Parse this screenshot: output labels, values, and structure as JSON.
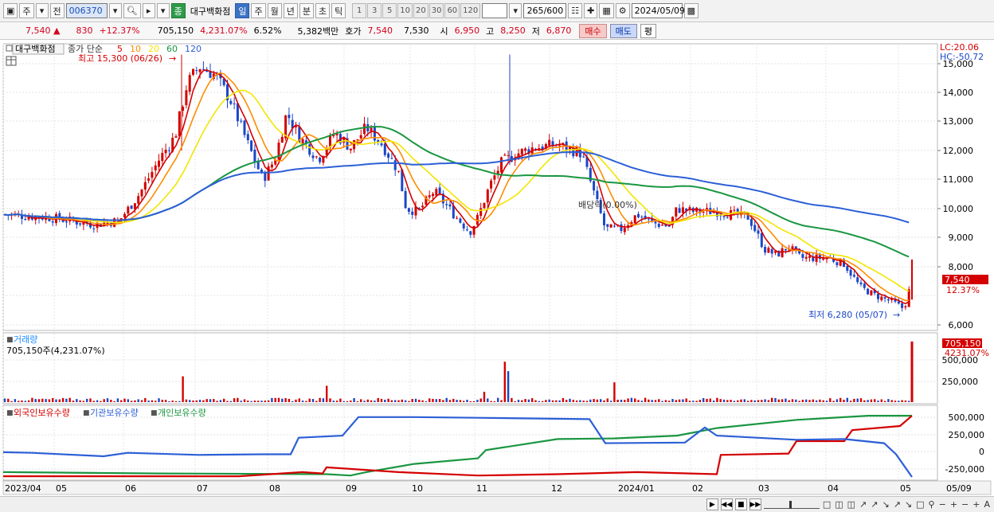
{
  "toolbar": {
    "type_selector": "주",
    "prev_label": "전",
    "stock_code": "006370",
    "stock_badge": "종",
    "stock_name": "대구백화점",
    "periods": [
      "일",
      "주",
      "월",
      "년",
      "분",
      "초",
      "틱"
    ],
    "active_period": "일",
    "minute_intervals": [
      "1",
      "3",
      "5",
      "10",
      "20",
      "30",
      "60",
      "120"
    ],
    "bar_count": "265",
    "bar_total": "/600",
    "date": "2024/05/09"
  },
  "quote": {
    "price": "7,540",
    "change": "830",
    "change_pct": "+12.37%",
    "volume": "705,150",
    "volume_pct": "4,231.07%",
    "turnover": "6.52%",
    "amount": "5,382백만",
    "bid_label": "호가",
    "bid1": "7,540",
    "bid2": "7,530",
    "open_label": "시",
    "open": "6,950",
    "high_label": "고",
    "high": "8,250",
    "low_label": "저",
    "low": "6,870",
    "buy_label": "매수",
    "sell_label": "매도",
    "avg_label": "평"
  },
  "price_panel": {
    "stock_name": "대구백화점",
    "legend_title": "종가 단순",
    "ma_periods": [
      "5",
      "10",
      "20",
      "60",
      "120"
    ],
    "ma_colors": [
      "#d40000",
      "#ff8c00",
      "#f2e600",
      "#1a9641",
      "#2c5fd6"
    ],
    "high_marker": "최고 15,300 (06/26)",
    "low_marker": "최저 6,280 (05/07)",
    "dividend_marker": "배당락(0.00%)",
    "lc_label": "LC:20.06",
    "hc_label": "HC:-50.72",
    "last_price": "7,540",
    "last_pct": "12.37%",
    "y_ticks": [
      "15,000",
      "14,000",
      "13,000",
      "12,000",
      "11,000",
      "10,000",
      "9,000",
      "8,000",
      "6,000"
    ]
  },
  "volume_panel": {
    "title": "거래량",
    "value_label": "705,150주(4,231.07%)",
    "last_value": "705,150",
    "last_pct": "4231.07%",
    "y_ticks": [
      "500,000",
      "250,000"
    ]
  },
  "holdings_panel": {
    "series": [
      "외국인보유수량",
      "기관보유수량",
      "개인보유수량"
    ],
    "series_colors": [
      "#d40000",
      "#2c5fd6",
      "#1a9641"
    ],
    "y_ticks": [
      "500,000",
      "250,000",
      "0",
      "-250,000"
    ]
  },
  "x_axis": {
    "labels": [
      "2023/04",
      "05",
      "06",
      "07",
      "08",
      "09",
      "10",
      "11",
      "12",
      "2024/01",
      "02",
      "03",
      "04",
      "05"
    ],
    "right_label": "05/09"
  }
}
